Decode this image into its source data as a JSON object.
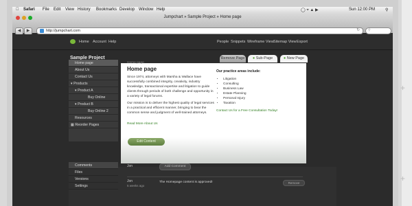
{
  "menubar": {
    "apple": "",
    "items": [
      "Safari",
      "File",
      "Edit",
      "View",
      "History",
      "Bookmarks",
      "Develop",
      "Window",
      "Help"
    ],
    "clock": "Sun 12:00 PM"
  },
  "browser": {
    "window_title": "Jumpchart » Sample Project » Home page",
    "url": "http://jumpchart.com"
  },
  "appbar": {
    "left_links": [
      "Home",
      "Account",
      "Help"
    ],
    "right_links": [
      "People",
      "Snippets",
      "Wireframe View",
      "Sitemap View",
      "Export"
    ]
  },
  "project": {
    "title": "Sample Project",
    "tabs": {
      "remove": "Remove Page",
      "sub": "Sub-Page",
      "new": "New Page"
    }
  },
  "sidebar": {
    "items": [
      "Home page",
      "About Us",
      "Contact Us",
      "Products",
      "Product A",
      "Buy Online",
      "Product B",
      "Buy Online 2",
      "Resources",
      "Reorder Pages"
    ],
    "bottom_items": [
      "Comments",
      "Files",
      "Versions",
      "Settings"
    ]
  },
  "page": {
    "breadcrumb": "Home page",
    "heading": "Home page",
    "para1": "Since 1974, attorneys with Marsha & Wallace have successfully combined integrity, creativity, industry knowledge, transactional expertise and litigation to guide clients through periods of both challenge and opportunity in a variety of legal forums.",
    "para2": "Our mission is to deliver the highest quality of legal services in a practical and efficient manner, bringing to bear the common sense and judgment of well-trained attorneys.",
    "read_more": "Read More About Us",
    "edit_button": "Edit Content",
    "practice_heading": "Our practice areas include:",
    "practice_items": [
      "Litigation",
      "Consulting",
      "Business Law",
      "Estate Planning",
      "Personal Injury",
      "Taxation"
    ],
    "consult_link": "Contact Us for a Free Consultation Today!"
  },
  "comments": {
    "user1": "Jon",
    "add_button": "Add Comment",
    "user2": "Jon",
    "time": "5 weeks ago",
    "message": "The Homepage content is approved!",
    "remove_button": "Remove"
  }
}
